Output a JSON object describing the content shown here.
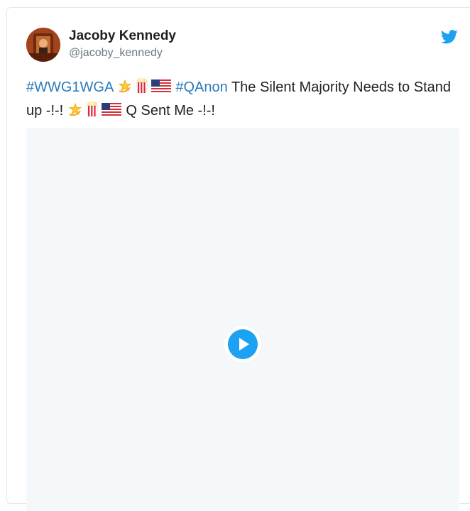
{
  "tweet": {
    "author": {
      "name": "Jacoby Kennedy",
      "handle": "@jacoby_kennedy"
    },
    "text": {
      "hashtag_1": "#WWG1WGA",
      "hashtag_2": "#QAnon",
      "body_1": "The Silent Majority Needs to Stand up -!-!",
      "body_2": "Q Sent Me -!-!"
    },
    "emoji_sequence": [
      "dizzy-star",
      "popcorn",
      "us-flag"
    ],
    "media": {
      "type": "video"
    }
  },
  "colors": {
    "link": "#2b7bb9",
    "text": "#1c2022",
    "muted": "#697882",
    "twitter_blue": "#1da1f2",
    "media_bg": "#f5f8fa"
  }
}
